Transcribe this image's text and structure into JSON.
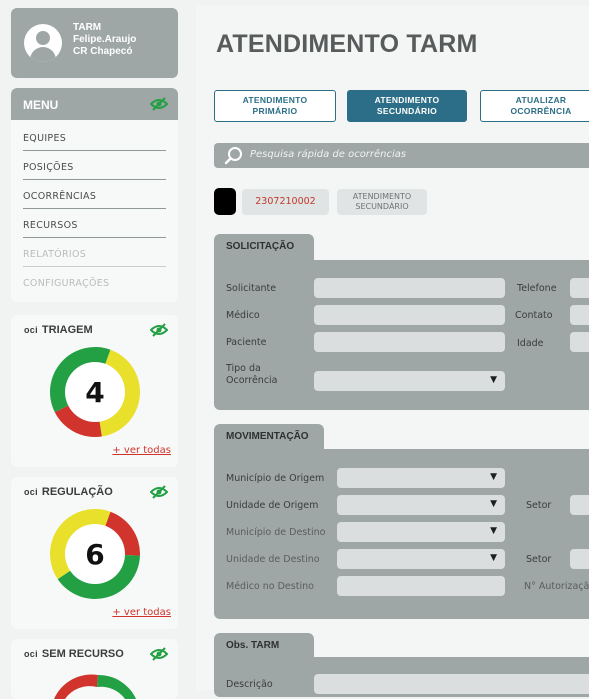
{
  "user": {
    "role": "TARM",
    "name": "Felipe.Araujo",
    "unit": "CR Chapecó"
  },
  "menu": {
    "title": "MENU",
    "items": [
      {
        "label": "EQUIPES"
      },
      {
        "label": "POSIÇÕES"
      },
      {
        "label": "OCORRÊNCIAS"
      },
      {
        "label": "RECURSOS"
      },
      {
        "label": "RELATÓRIOS"
      },
      {
        "label": "CONFIGURAÇÕES"
      }
    ]
  },
  "gauges": [
    {
      "prefix": "oci",
      "title": "TRIAGEM",
      "count": "4",
      "link": "+ ver todas",
      "segments": [
        {
          "color": "#e8e02a",
          "value": 0.42
        },
        {
          "color": "#d0342c",
          "value": 0.2
        },
        {
          "color": "#23a043",
          "value": 0.38
        }
      ]
    },
    {
      "prefix": "oci",
      "title": "REGULAÇÃO",
      "count": "6",
      "link": "+ ver todas",
      "segments": [
        {
          "color": "#d0342c",
          "value": 0.2
        },
        {
          "color": "#23a043",
          "value": 0.4
        },
        {
          "color": "#e8e02a",
          "value": 0.4
        }
      ]
    },
    {
      "prefix": "oci",
      "title": "SEM RECURSO"
    }
  ],
  "page": {
    "title": "ATENDIMENTO TARM"
  },
  "tabs": [
    {
      "line1": "ATENDIMENTO",
      "line2": "PRIMÁRIO",
      "active": false
    },
    {
      "line1": "ATENDIMENTO",
      "line2": "SECUNDÁRIO",
      "active": true
    },
    {
      "line1": "ATUALIZAR",
      "line2": "OCORRÊNCIA",
      "active": false
    }
  ],
  "search": {
    "placeholder": "Pesquisa rápida de ocorrências"
  },
  "occurrence": {
    "number": "2307210002",
    "type_line1": "ATENDIMENTO",
    "type_line2": "SECUNDÁRIO"
  },
  "solicitacao": {
    "title": "SOLICITAÇÃO",
    "solicitante": "Solicitante",
    "telefone": "Telefone",
    "medico": "Médico",
    "contato": "Contato",
    "paciente": "Paciente",
    "idade": "Idade",
    "tipo_line1": "Tipo da",
    "tipo_line2": "Ocorrência"
  },
  "movimentacao": {
    "title": "MOVIMENTAÇÃO",
    "municipio_origem": "Município de Origem",
    "unidade_origem": "Unidade de Origem",
    "setor1": "Setor",
    "municipio_destino": "Município de Destino",
    "unidade_destino": "Unidade de Destino",
    "setor2": "Setor",
    "medico_destino": "Médico no Destino",
    "autorizacao": "N° Autorização"
  },
  "obs": {
    "title": "Obs. TARM",
    "descricao": "Descrição"
  },
  "colors": {
    "accent": "#2c6e87",
    "panel": "#9ea6a6",
    "link": "#d0342c",
    "eye": "#23a043"
  }
}
